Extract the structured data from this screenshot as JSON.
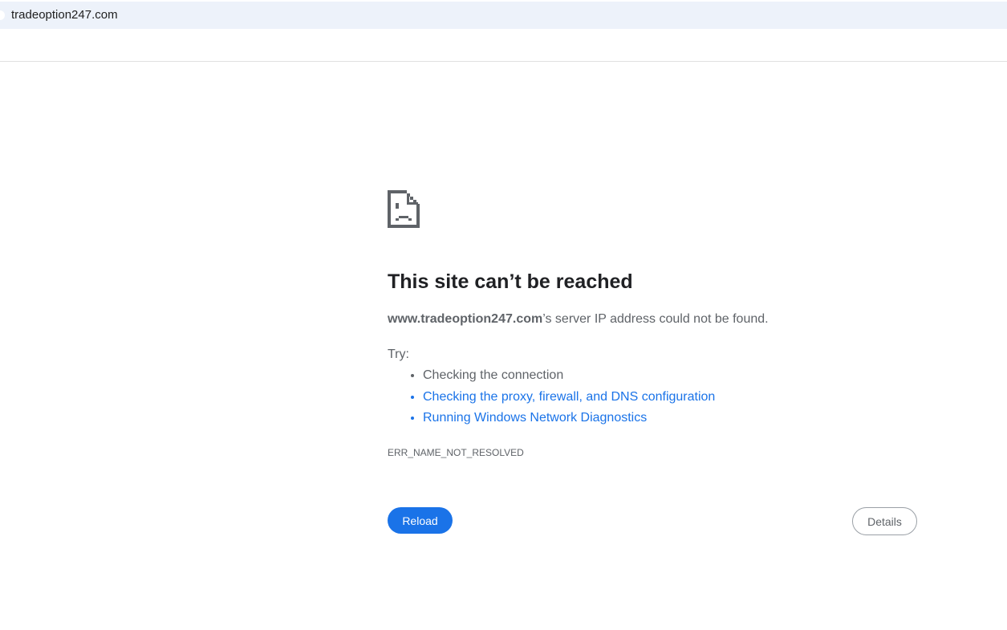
{
  "address_bar": {
    "url": "tradeoption247.com"
  },
  "error": {
    "icon": "sad-page-icon",
    "title": "This site can’t be reached",
    "host": "www.tradeoption247.com",
    "message": "’s server IP address could not be found.",
    "try_label": "Try:",
    "suggestions": [
      "Checking the connection",
      "Checking the proxy, firewall, and DNS configuration",
      "Running Windows Network Diagnostics"
    ],
    "code": "ERR_NAME_NOT_RESOLVED"
  },
  "buttons": {
    "reload": "Reload",
    "details": "Details"
  }
}
